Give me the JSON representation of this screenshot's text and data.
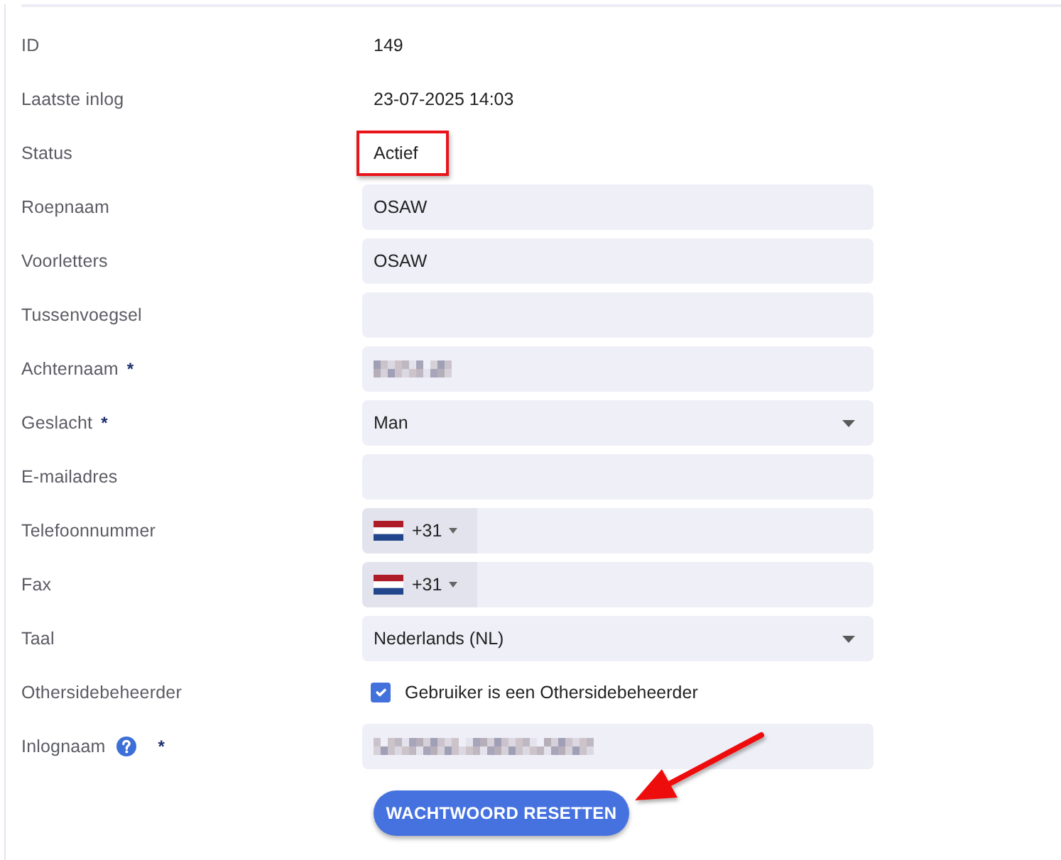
{
  "form": {
    "rows": [
      {
        "kind": "static",
        "label": "ID",
        "value": "149",
        "highlighted": false,
        "help": false
      },
      {
        "kind": "static",
        "label": "Laatste inlog",
        "value": "23-07-2025 14:03",
        "highlighted": false,
        "help": false
      },
      {
        "kind": "static",
        "label": "Status",
        "value": "Actief",
        "highlighted": true,
        "help": false
      },
      {
        "kind": "text",
        "label": "Roepnaam",
        "value": "OSAW",
        "blurred": false,
        "help": false
      },
      {
        "kind": "text",
        "label": "Voorletters",
        "value": "OSAW",
        "blurred": false,
        "help": false
      },
      {
        "kind": "text",
        "label": "Tussenvoegsel",
        "blurred": false,
        "help": false
      },
      {
        "kind": "text",
        "label": "Achternaam",
        "required_mark": "*",
        "blurred": true,
        "help": false
      },
      {
        "kind": "select",
        "label": "Geslacht",
        "required_mark": "*",
        "value": "Man",
        "help": false
      },
      {
        "kind": "text",
        "label": "E-mailadres",
        "blurred": false,
        "help": false
      },
      {
        "kind": "phone",
        "label": "Telefoonnummer",
        "dial_code": "+31",
        "help": false
      },
      {
        "kind": "phone",
        "label": "Fax",
        "dial_code": "+31",
        "help": false
      },
      {
        "kind": "select",
        "label": "Taal",
        "value": "Nederlands (NL)",
        "help": false
      },
      {
        "kind": "checkbox",
        "label": "Othersidebeheerder",
        "checkbox_label": "Gebruiker is een Othersidebeheerder",
        "checked": true,
        "help": false
      },
      {
        "kind": "text",
        "label": "Inlognaam",
        "help": true,
        "required_mark": "*",
        "blurred": true
      }
    ]
  },
  "reset_button": {
    "label": "WACHTWOORD RESETTEN",
    "arrow": true
  }
}
